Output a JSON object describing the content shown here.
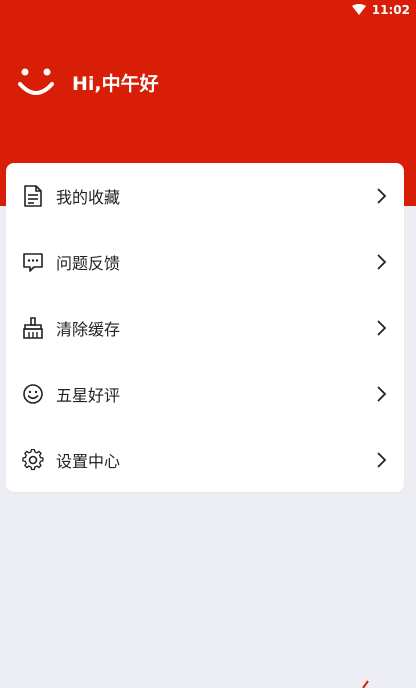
{
  "status_bar": {
    "time": "11:02",
    "icons": [
      "wifi-icon"
    ]
  },
  "header": {
    "greeting": "Hi,中午好",
    "icon": "smile-icon",
    "background": "#d81e06"
  },
  "menu": {
    "items": [
      {
        "label": "我的收藏",
        "icon": "document-icon"
      },
      {
        "label": "问题反馈",
        "icon": "chat-bubble-icon"
      },
      {
        "label": "清除缓存",
        "icon": "broom-icon"
      },
      {
        "label": "五星好评",
        "icon": "smiley-face-icon"
      },
      {
        "label": "设置中心",
        "icon": "gear-icon"
      }
    ],
    "chevron_icon": "chevron-right-icon"
  },
  "colors": {
    "accent": "#d81e06",
    "page_background": "#eceef3",
    "card_background": "#ffffff",
    "text": "#222222"
  }
}
